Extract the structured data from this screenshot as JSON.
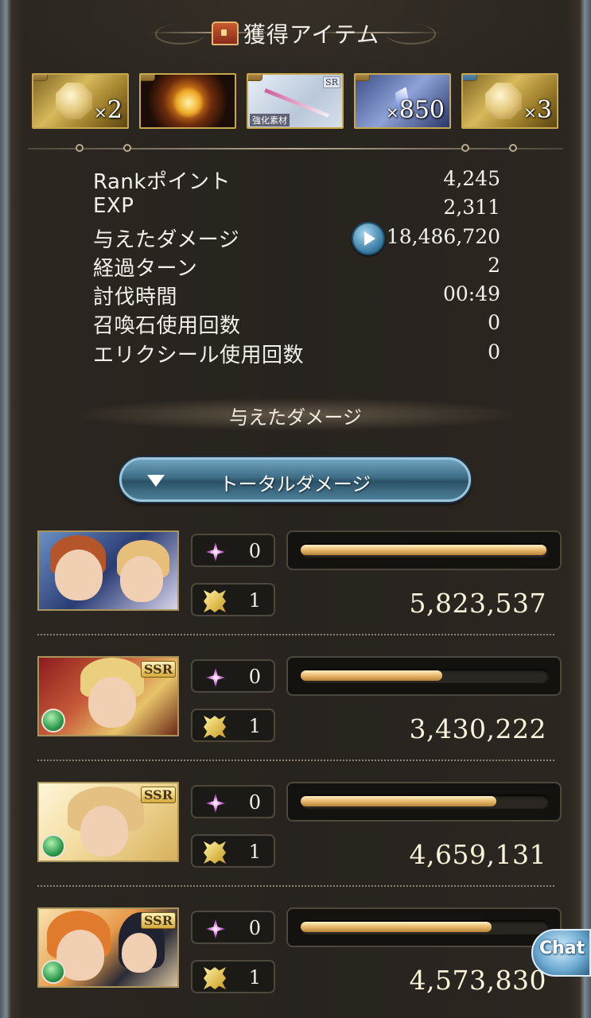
{
  "header": {
    "title": "獲得アイテム",
    "icon": "treasure-chest-icon"
  },
  "items": [
    {
      "name": "gold-crystal-item",
      "quantity": "2"
    },
    {
      "name": "fire-orb-item",
      "quantity": ""
    },
    {
      "name": "enhancement-sword-item",
      "rarity": "SR",
      "tag": "強化素材",
      "quantity": ""
    },
    {
      "name": "crystal-item",
      "quantity": "850"
    },
    {
      "name": "gold-crystal-item",
      "quantity": "3"
    }
  ],
  "stats": [
    {
      "label": "Rankポイント",
      "value": "4,245"
    },
    {
      "label": "EXP",
      "value": "2,311"
    },
    {
      "label": "与えたダメージ",
      "value": "18,486,720"
    },
    {
      "label": "経過ターン",
      "value": "2"
    },
    {
      "label": "討伐時間",
      "value": "00:49"
    },
    {
      "label": "召喚石使用回数",
      "value": "0"
    },
    {
      "label": "エリクシール使用回数",
      "value": "0"
    }
  ],
  "section_title": "与えたダメージ",
  "dropdown": {
    "label": "トータルダメージ"
  },
  "characters": [
    {
      "name": "party-member-1",
      "ssr": "",
      "ougi_count": "0",
      "burst_count": "1",
      "damage": "5,823,537",
      "bar_fraction": 0.99
    },
    {
      "name": "party-member-2",
      "ssr": "SSR",
      "ougi_count": "0",
      "burst_count": "1",
      "damage": "3,430,222",
      "bar_fraction": 0.57
    },
    {
      "name": "party-member-3",
      "ssr": "SSR",
      "ougi_count": "0",
      "burst_count": "1",
      "damage": "4,659,131",
      "bar_fraction": 0.79
    },
    {
      "name": "party-member-4",
      "ssr": "SSR",
      "ougi_count": "0",
      "burst_count": "1",
      "damage": "4,573,830",
      "bar_fraction": 0.77
    }
  ],
  "chat_button": {
    "label": "Chat"
  },
  "colors": {
    "bar_fill": "#e8b96a",
    "accent_blue": "#3e6d86",
    "gold_border": "#c8a74f"
  }
}
